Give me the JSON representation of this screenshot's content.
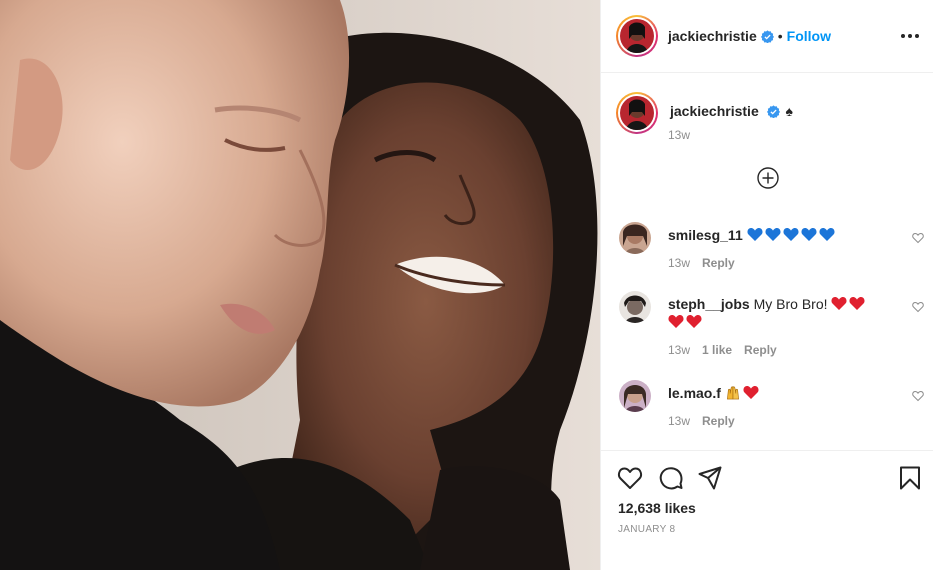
{
  "post": {
    "photo_alt": "",
    "author": {
      "username": "jackiechristie",
      "verified": true,
      "follow_label": "Follow",
      "more_icon": "more-options-icon"
    },
    "caption": {
      "username": "jackiechristie",
      "text": "♠",
      "time": "13w"
    },
    "load_more_icon": "plus-circle-icon",
    "comments": [
      {
        "username": "smilesg_11",
        "text": "",
        "emojis": [
          "blue-heart",
          "blue-heart",
          "blue-heart",
          "blue-heart",
          "blue-heart"
        ],
        "time": "13w",
        "likes": "",
        "reply": "Reply"
      },
      {
        "username": "steph__jobs",
        "text": "My Bro Bro!",
        "emojis": [
          "red-heart",
          "red-heart",
          "red-heart",
          "red-heart"
        ],
        "time": "13w",
        "likes": "1 like",
        "reply": "Reply"
      },
      {
        "username": "le.mao.f",
        "text": "",
        "emojis": [
          "raising-hands",
          "red-heart"
        ],
        "time": "13w",
        "likes": "",
        "reply": "Reply"
      }
    ],
    "actions": {
      "like_icon": "heart-outline-icon",
      "comment_icon": "comment-bubble-icon",
      "share_icon": "paper-plane-icon",
      "save_icon": "bookmark-icon"
    },
    "likes_count": "12,638 likes",
    "date": "JANUARY 8",
    "colors": {
      "link_blue": "#0095f6",
      "verified_blue": "#3897f0",
      "muted": "#8e8e8e",
      "text": "#262626",
      "divider": "#efefef"
    }
  }
}
